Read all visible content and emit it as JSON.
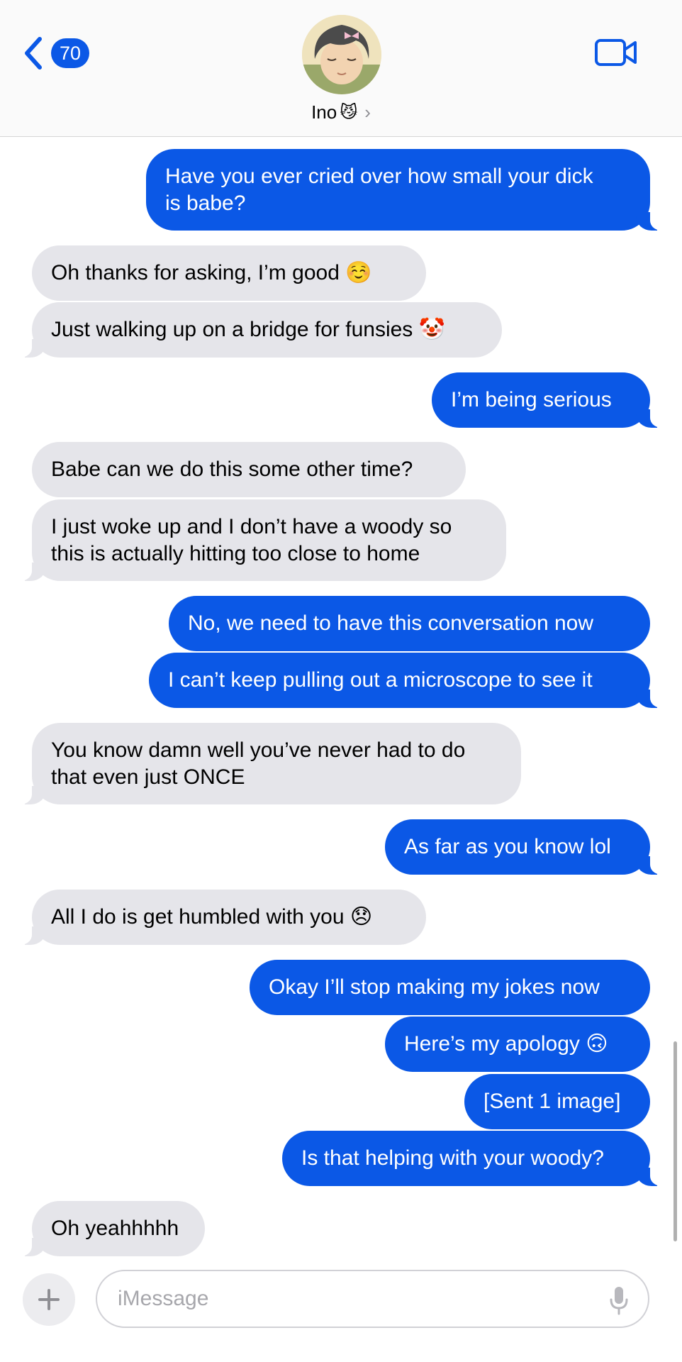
{
  "header": {
    "back_count": "70",
    "contact_name": "Ino",
    "contact_emoji": "😼",
    "contact_chevron": "›",
    "icons": {
      "back": "chevron-left-icon",
      "video": "video-camera-icon"
    },
    "accent_color": "#0b58e6"
  },
  "messages": [
    {
      "direction": "out",
      "text": "Have you ever cried over how small your dick\nis babe?"
    },
    {
      "direction": "in",
      "text": "Oh thanks for asking, I’m good ☺️"
    },
    {
      "direction": "in",
      "text": "Just walking up on a bridge for funsies 🤡"
    },
    {
      "direction": "out",
      "text": "I’m being serious"
    },
    {
      "direction": "in",
      "text": "Babe can we do this some other time?"
    },
    {
      "direction": "in",
      "text": "I just woke up and I don’t have a woody so\nthis is actually hitting too close to home"
    },
    {
      "direction": "out",
      "text": "No, we need to have this conversation now"
    },
    {
      "direction": "out",
      "text": "I can’t keep pulling out a microscope to see it"
    },
    {
      "direction": "in",
      "text": "You know damn well you’ve never had to do\nthat even just ONCE"
    },
    {
      "direction": "out",
      "text": "As far as you know lol"
    },
    {
      "direction": "in",
      "text": "All I do is get humbled with you 😞"
    },
    {
      "direction": "out",
      "text": "Okay I’ll stop making my jokes now"
    },
    {
      "direction": "out",
      "text": "Here’s my apology 🙃"
    },
    {
      "direction": "out",
      "text": "[Sent 1 image]"
    },
    {
      "direction": "out",
      "text": "Is that helping with your woody?"
    },
    {
      "direction": "in",
      "text": "Oh yeahhhhh"
    }
  ],
  "composer": {
    "placeholder": "iMessage",
    "icons": {
      "add": "plus-icon",
      "mic": "microphone-icon"
    }
  }
}
